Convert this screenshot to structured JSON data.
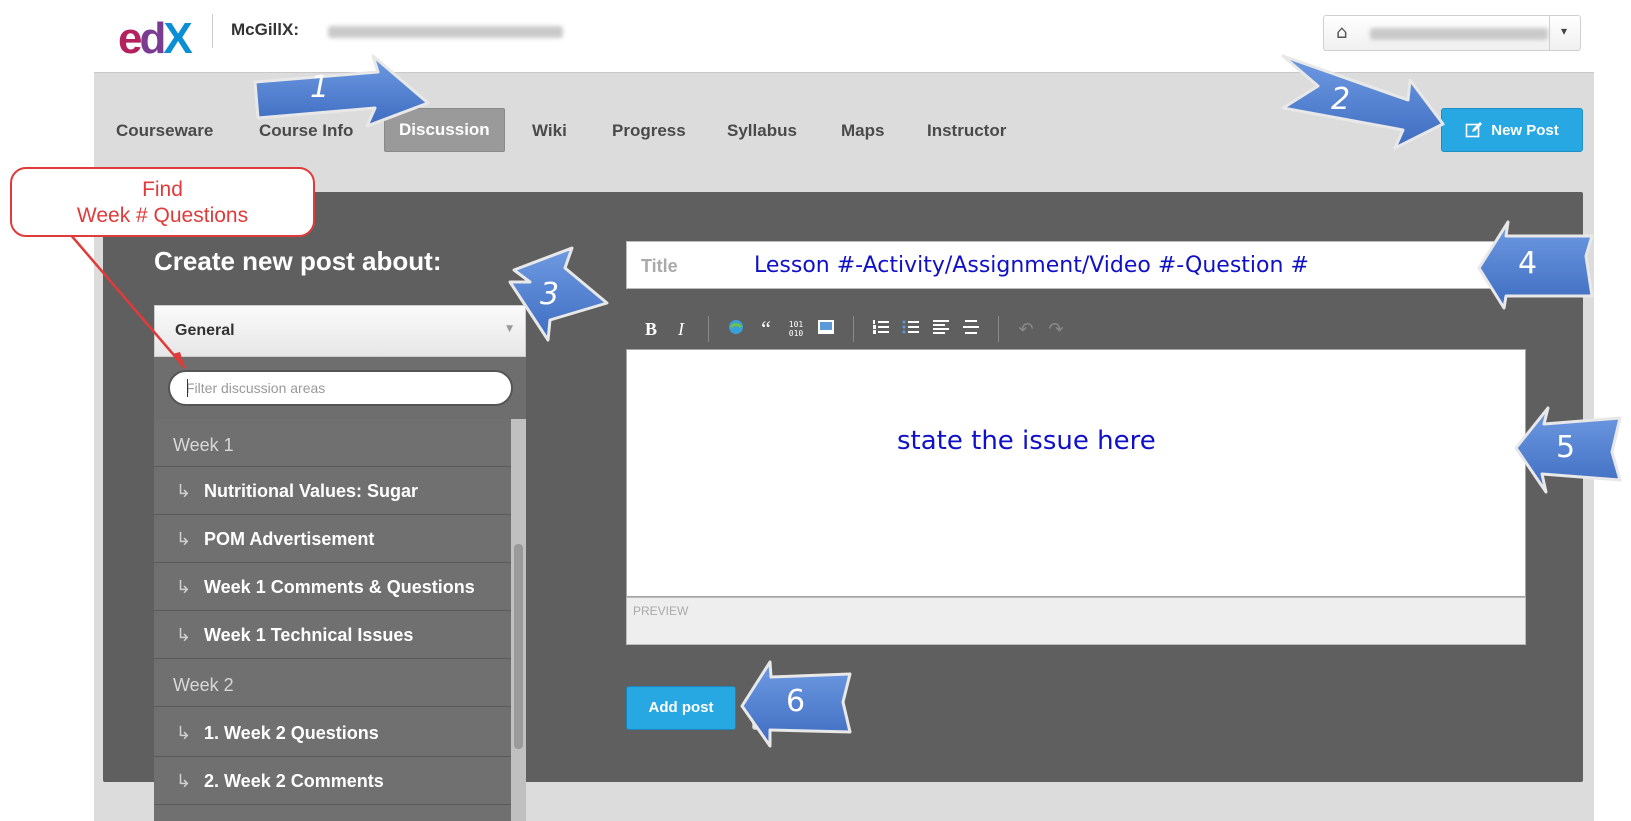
{
  "header": {
    "logo_parts": [
      "e",
      "d",
      "X"
    ],
    "course_prefix": "McGillX:",
    "course_name_blurred": true,
    "user_menu": {
      "home_icon": "home-icon",
      "username_blurred": true,
      "caret": "▾"
    }
  },
  "nav": {
    "items": [
      {
        "label": "Courseware",
        "active": false
      },
      {
        "label": "Course Info",
        "active": false
      },
      {
        "label": "Discussion",
        "active": true
      },
      {
        "label": "Wiki",
        "active": false
      },
      {
        "label": "Progress",
        "active": false
      },
      {
        "label": "Syllabus",
        "active": false
      },
      {
        "label": "Maps",
        "active": false
      },
      {
        "label": "Instructor",
        "active": false
      }
    ],
    "new_post_label": "New Post",
    "new_post_icon": "edit-icon"
  },
  "form": {
    "heading": "Create new post about:",
    "topic_selected": "General",
    "filter_placeholder": "Filter discussion areas",
    "title_placeholder": "Title",
    "title_value": "Lesson #-Activity/Assignment/Video #-Question #",
    "body_value": "state the issue here",
    "preview_label": "PREVIEW",
    "add_post_label": "Add post"
  },
  "topics": [
    {
      "label": "Week 1",
      "type": "week"
    },
    {
      "label": "Nutritional Values: Sugar",
      "type": "sub"
    },
    {
      "label": "POM Advertisement",
      "type": "sub"
    },
    {
      "label": "Week 1 Comments & Questions",
      "type": "sub"
    },
    {
      "label": "Week 1 Technical Issues",
      "type": "sub"
    },
    {
      "label": "Week 2",
      "type": "week"
    },
    {
      "label": "1. Week 2 Questions",
      "type": "sub"
    },
    {
      "label": "2. Week 2 Comments",
      "type": "sub"
    }
  ],
  "toolbar": {
    "bold": "B",
    "italic": "I",
    "link_icon": "link-icon",
    "quote": "“",
    "code": "101 010",
    "image_icon": "image-icon",
    "ol_icon": "ordered-list-icon",
    "ul_icon": "unordered-list-icon",
    "heading_icon": "heading-icon",
    "hr_icon": "horizontal-rule-icon",
    "undo": "↶",
    "redo": "↷"
  },
  "annotations": {
    "callout_text_line1": "Find",
    "callout_text_line2": "Week # Questions",
    "step_numbers": [
      "1",
      "2",
      "3",
      "4",
      "5",
      "6"
    ],
    "arrow_color": "#4a78c9",
    "callout_color": "#e03b3b"
  }
}
